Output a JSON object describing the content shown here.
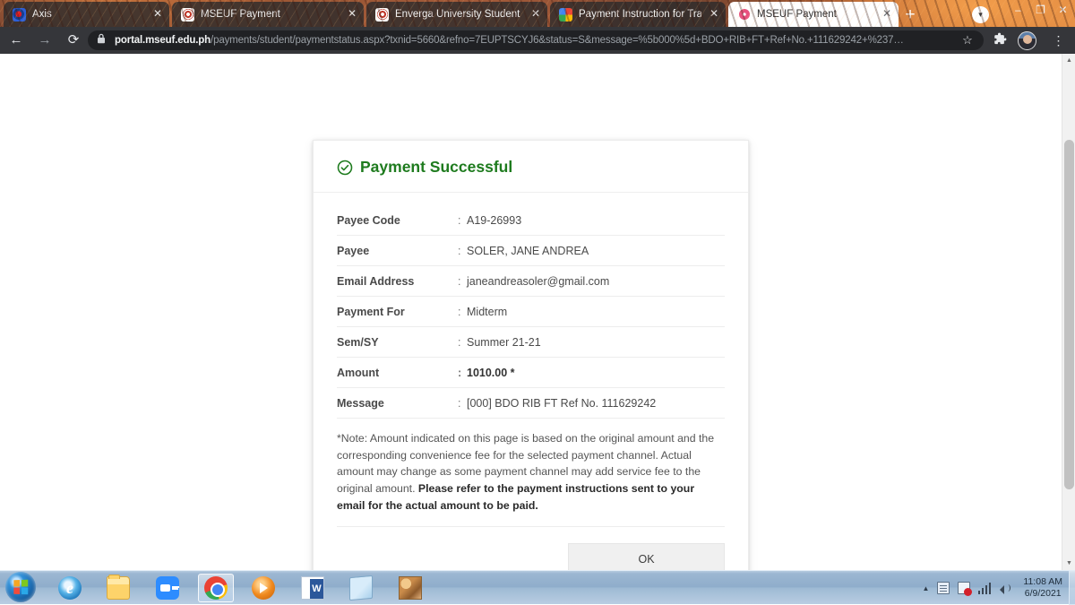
{
  "browser": {
    "tabs": [
      {
        "label": "Axis",
        "favicon": "axis-logo-icon",
        "active": false
      },
      {
        "label": "MSEUF Payment",
        "favicon": "mseuf-logo-icon",
        "active": false
      },
      {
        "label": "Enverga University Student Inf",
        "favicon": "mseuf-logo-icon",
        "active": false
      },
      {
        "label": "Payment Instruction for Trans",
        "favicon": "google-logo-icon",
        "active": false
      },
      {
        "label": "MSEUF Payment",
        "favicon": "mseuf-logo-icon",
        "active": true
      }
    ],
    "new_tab_label": "+",
    "tab_search_label": "▾",
    "window_controls": {
      "minimize": "–",
      "maximize": "❐",
      "close": "✕"
    },
    "toolbar": {
      "back_label": "←",
      "forward_label": "→",
      "reload_label": "⟳",
      "lock_label": "secure-lock-icon",
      "url_domain": "portal.mseuf.edu.ph",
      "url_path": "/payments/student/paymentstatus.aspx?txnid=5660&refno=7EUPTSCYJ6&status=S&message=%5b000%5d+BDO+RIB+FT+Ref+No.+111629242+%237…",
      "bookmark_label": "☆",
      "extensions_label": "extensions-puzzle-icon",
      "profile_label": "profile-avatar",
      "menu_label": "⋮"
    }
  },
  "page": {
    "card": {
      "status_icon": "check-circle-icon",
      "title": "Payment Successful",
      "title_color": "#1e7b1e",
      "rows": [
        {
          "label": "Payee Code",
          "value": "A19-26993",
          "bold_value": false
        },
        {
          "label": "Payee",
          "value": "SOLER, JANE ANDREA",
          "bold_value": false
        },
        {
          "label": "Email Address",
          "value": "janeandreasoler@gmail.com",
          "bold_value": false
        },
        {
          "label": "Payment For",
          "value": "Midterm",
          "bold_value": false
        },
        {
          "label": "Sem/SY",
          "value": "Summer 21-21",
          "bold_value": false
        },
        {
          "label": "Amount",
          "value": "1010.00 *",
          "bold_value": true
        },
        {
          "label": "Message",
          "value": "[000] BDO RIB FT Ref No. 111629242",
          "bold_value": false
        }
      ],
      "separator": ":",
      "note_plain": "*Note: Amount indicated on this page is based on the original amount and the corresponding convenience fee for the selected payment channel. Actual amount may change as some payment channel may add service fee to the original amount. ",
      "note_bold": "Please refer to the payment instructions sent to your email for the actual amount to be paid.",
      "ok_label": "OK"
    },
    "scrollbar": {
      "up_arrow": "▲",
      "down_arrow": "▼"
    }
  },
  "taskbar": {
    "start_label": "start-orb-icon",
    "items": [
      {
        "name": "internet-explorer",
        "icon": "ic-ie",
        "active": false
      },
      {
        "name": "file-explorer",
        "icon": "ic-folder",
        "active": false
      },
      {
        "name": "zoom",
        "icon": "ic-zoom",
        "active": false
      },
      {
        "name": "google-chrome",
        "icon": "ic-chrome",
        "active": true
      },
      {
        "name": "media-player",
        "icon": "ic-media",
        "active": false
      },
      {
        "name": "microsoft-word",
        "icon": "ic-word",
        "active": false
      },
      {
        "name": "notepad",
        "icon": "ic-note",
        "active": false
      },
      {
        "name": "photo-viewer",
        "icon": "ic-photo",
        "active": false
      }
    ],
    "tray": {
      "caret": "▲",
      "icons": [
        "action-center-icon",
        "network-error-icon",
        "signal-bars-icon",
        "volume-icon"
      ],
      "time": "11:08 AM",
      "date": "6/9/2021"
    }
  }
}
